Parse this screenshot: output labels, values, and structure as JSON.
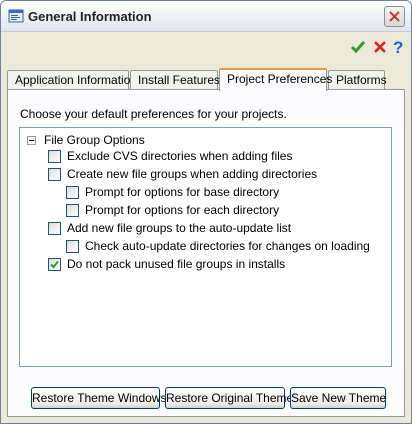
{
  "window": {
    "title": "General Information",
    "title_icon": "app-window-icon"
  },
  "toolbar": {
    "ok_icon": "checkmark-icon",
    "cancel_icon": "red-x-icon",
    "help_icon": "help-question-icon"
  },
  "tabs": [
    {
      "label": "Application Information",
      "active": false
    },
    {
      "label": "Install Features",
      "active": false
    },
    {
      "label": "Project Preferences",
      "active": true
    },
    {
      "label": "Platforms",
      "active": false
    }
  ],
  "panel": {
    "description": "Choose your default preferences for your projects.",
    "tree": {
      "group_label": "File Group Options",
      "group_expanded": true,
      "items": [
        {
          "label": "Exclude CVS directories when adding files",
          "checked": false
        },
        {
          "label": "Create new file groups when adding directories",
          "checked": false
        },
        {
          "label": "Prompt for options for base directory",
          "checked": false
        },
        {
          "label": "Prompt for options for each directory",
          "checked": false
        },
        {
          "label": "Add new file groups to the auto-update list",
          "checked": false
        },
        {
          "label": "Check auto-update directories for changes on loading",
          "checked": false
        },
        {
          "label": "Do not pack unused file groups in installs",
          "checked": true
        }
      ]
    }
  },
  "buttons": {
    "restore_windows": "Restore Theme Windows",
    "restore_original": "Restore Original Theme",
    "save_new": "Save New Theme"
  },
  "colors": {
    "check_green": "#2e9a2e",
    "cancel_red": "#d32626",
    "help_blue": "#1f5fd6",
    "active_tab_accent": "#e69a3c"
  }
}
